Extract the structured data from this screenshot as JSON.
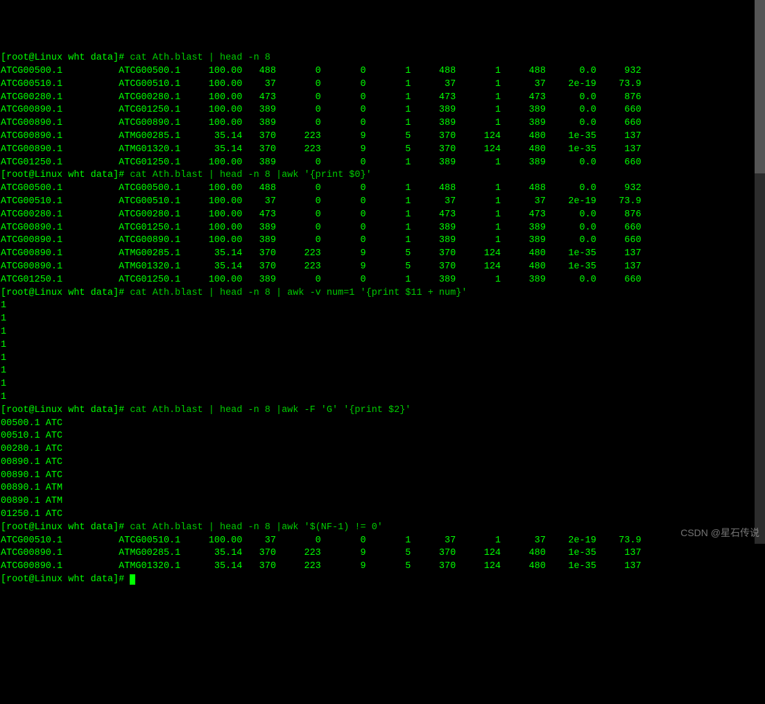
{
  "prompt": "[root@Linux wht data]# ",
  "commands": {
    "c1": "cat Ath.blast | head -n 8",
    "c2": "cat Ath.blast | head -n 8 |awk '{print $0}'",
    "c3": "cat Ath.blast | head -n 8 | awk -v num=1 '{print $11 + num}'",
    "c4": "cat Ath.blast | head -n 8 |awk -F 'G' '{print $2}'",
    "c5": "cat Ath.blast | head -n 8 |awk '$(NF-1) != 0'"
  },
  "table1": [
    [
      "ATCG00500.1",
      "ATCG00500.1",
      "100.00",
      "488",
      "0",
      "0",
      "1",
      "488",
      "1",
      "488",
      "0.0",
      "932"
    ],
    [
      "ATCG00510.1",
      "ATCG00510.1",
      "100.00",
      "37",
      "0",
      "0",
      "1",
      "37",
      "1",
      "37",
      "2e-19",
      "73.9"
    ],
    [
      "ATCG00280.1",
      "ATCG00280.1",
      "100.00",
      "473",
      "0",
      "0",
      "1",
      "473",
      "1",
      "473",
      "0.0",
      "876"
    ],
    [
      "ATCG00890.1",
      "ATCG01250.1",
      "100.00",
      "389",
      "0",
      "0",
      "1",
      "389",
      "1",
      "389",
      "0.0",
      "660"
    ],
    [
      "ATCG00890.1",
      "ATCG00890.1",
      "100.00",
      "389",
      "0",
      "0",
      "1",
      "389",
      "1",
      "389",
      "0.0",
      "660"
    ],
    [
      "ATCG00890.1",
      "ATMG00285.1",
      "35.14",
      "370",
      "223",
      "9",
      "5",
      "370",
      "124",
      "480",
      "1e-35",
      "137"
    ],
    [
      "ATCG00890.1",
      "ATMG01320.1",
      "35.14",
      "370",
      "223",
      "9",
      "5",
      "370",
      "124",
      "480",
      "1e-35",
      "137"
    ],
    [
      "ATCG01250.1",
      "ATCG01250.1",
      "100.00",
      "389",
      "0",
      "0",
      "1",
      "389",
      "1",
      "389",
      "0.0",
      "660"
    ]
  ],
  "out3": [
    "1",
    "1",
    "1",
    "1",
    "1",
    "1",
    "1",
    "1"
  ],
  "out4": [
    "00500.1 ATC",
    "00510.1 ATC",
    "00280.1 ATC",
    "00890.1 ATC",
    "00890.1 ATC",
    "00890.1 ATM",
    "00890.1 ATM",
    "01250.1 ATC"
  ],
  "table5": [
    [
      "ATCG00510.1",
      "ATCG00510.1",
      "100.00",
      "37",
      "0",
      "0",
      "1",
      "37",
      "1",
      "37",
      "2e-19",
      "73.9"
    ],
    [
      "ATCG00890.1",
      "ATMG00285.1",
      "35.14",
      "370",
      "223",
      "9",
      "5",
      "370",
      "124",
      "480",
      "1e-35",
      "137"
    ],
    [
      "ATCG00890.1",
      "ATMG01320.1",
      "35.14",
      "370",
      "223",
      "9",
      "5",
      "370",
      "124",
      "480",
      "1e-35",
      "137"
    ]
  ],
  "watermark": "CSDN @星石传说"
}
